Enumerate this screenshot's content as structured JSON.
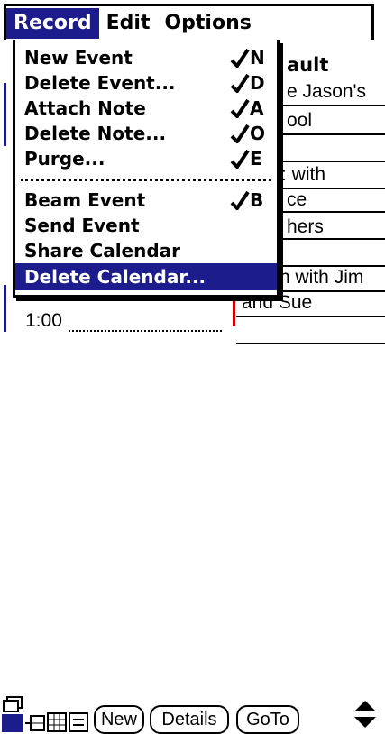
{
  "menubar": {
    "menus": [
      "Record",
      "Edit",
      "Options"
    ]
  },
  "record_menu": {
    "items": [
      {
        "label": "New Event",
        "shortcut": "N"
      },
      {
        "label": "Delete Event...",
        "shortcut": "D"
      },
      {
        "label": "Attach Note",
        "shortcut": "A"
      },
      {
        "label": "Delete Note...",
        "shortcut": "O"
      },
      {
        "label": "Purge...",
        "shortcut": "E"
      },
      {
        "label": "Beam Event",
        "shortcut": "B"
      },
      {
        "label": "Send Event",
        "shortcut": ""
      },
      {
        "label": "Share Calendar",
        "shortcut": ""
      },
      {
        "label": "Delete Calendar...",
        "shortcut": ""
      }
    ],
    "selected_label": "Delete Calendar..."
  },
  "dayview": {
    "fragments": [
      "ault",
      "e Jason's",
      "ool",
      ": with",
      "ce",
      "hers",
      "h with Jim",
      "and Sue"
    ],
    "time_label": "1:00"
  },
  "toolbar": {
    "new_label": "New",
    "details_label": "Details",
    "goto_label": "GoTo"
  },
  "colors": {
    "accent": "#1c1c8c",
    "event_marker": "#d00000"
  }
}
